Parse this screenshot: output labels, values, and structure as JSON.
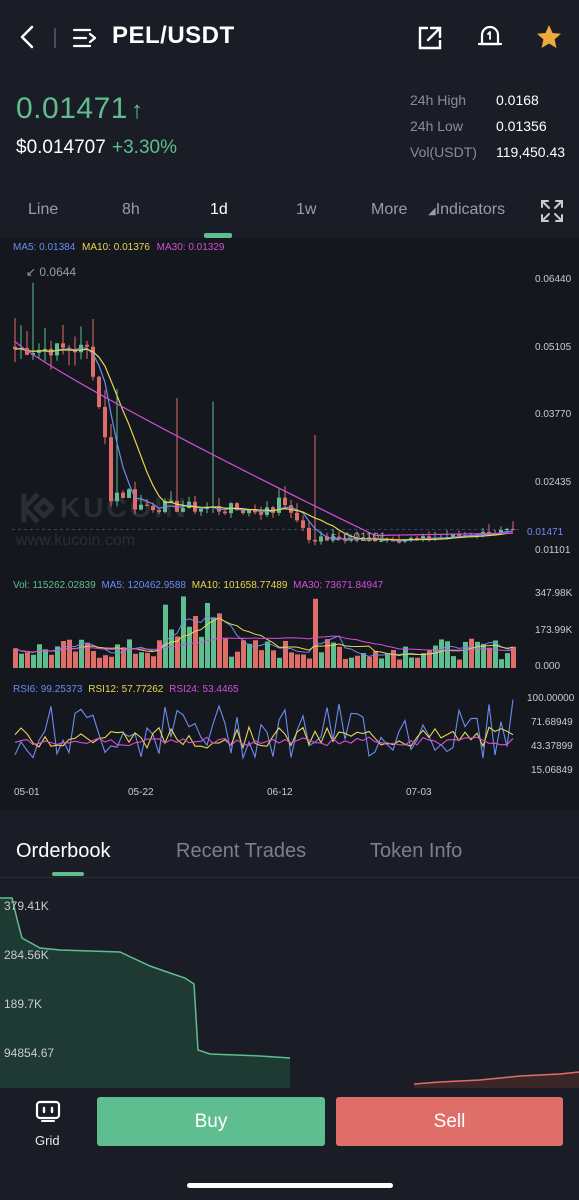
{
  "header": {
    "pair": "PEL/USDT",
    "icons": [
      "back-icon",
      "menu-icon",
      "share-icon",
      "price-alert-icon",
      "favorite-star-icon"
    ],
    "star_color": "#f0a93b"
  },
  "ticker": {
    "last_price": "0.01471",
    "arrow": "↑",
    "usd_price": "$0.014707",
    "change_pct": "+3.30%",
    "stats": [
      {
        "label": "24h High",
        "value": "0.0168"
      },
      {
        "label": "24h Low",
        "value": "0.01356"
      },
      {
        "label": "Vol(USDT)",
        "value": "119,450.43"
      }
    ]
  },
  "timeframes": {
    "items": [
      "Line",
      "8h",
      "1d",
      "1w",
      "More"
    ],
    "active": "1d",
    "indicators_label": "Indicators",
    "indicators_arrow": "◢"
  },
  "chart": {
    "ma_legend": {
      "ma5": "MA5: 0.01384",
      "ma10": "MA10: 0.01376",
      "ma30": "MA30: 0.01329"
    },
    "high_marker": "0.0644",
    "low_marker": "0.01101",
    "current_tag": "0.01471",
    "price_axis": [
      "0.06440",
      "0.05105",
      "0.03770",
      "0.02435",
      "0.01101"
    ],
    "watermark_brand": "KUCOIN",
    "watermark_url": "www.kucoin.com",
    "vol_legend": {
      "vol": "Vol: 115262.02839",
      "ma5": "MA5: 120462.9588",
      "ma10": "MA10: 101658.77489",
      "ma30": "MA30: 73671.84947"
    },
    "vol_axis": [
      "347.98K",
      "173.99K",
      "0.000"
    ],
    "rsi_legend": {
      "rsi6": "RSI6: 99.25373",
      "rsi12": "RSI12: 57.77262",
      "rsi24": "RSI24: 53.4465"
    },
    "rsi_axis": [
      "100.00000",
      "71.68949",
      "43.37899",
      "15.06849"
    ],
    "dates": [
      "05-01",
      "05-22",
      "06-12",
      "07-03"
    ],
    "colors": {
      "up": "#5ebe8f",
      "down": "#e06e68",
      "ma5": "#6b8cf2",
      "ma10": "#e8d84a",
      "ma30": "#d44fd6"
    }
  },
  "chart_data": {
    "type": "candlestick",
    "x": [
      "05-01",
      "05-22",
      "06-12",
      "07-03"
    ],
    "close_approx": [
      0.05,
      0.033,
      0.02,
      0.0175,
      0.018,
      0.0176,
      0.0172,
      0.0175,
      0.018,
      0.0178,
      0.012,
      0.0118,
      0.0125,
      0.013,
      0.0128,
      0.0135,
      0.0132,
      0.0138,
      0.014,
      0.0145,
      0.01471
    ],
    "ylim": [
      0.01101,
      0.0644
    ],
    "high": 0.0644,
    "low": 0.01101
  },
  "orderbook": {
    "tabs": [
      "Orderbook",
      "Recent Trades",
      "Token Info"
    ],
    "active": "Orderbook",
    "depth_labels": [
      "379.41K",
      "284.56K",
      "189.7K",
      "94854.67"
    ]
  },
  "bottom": {
    "grid_label": "Grid",
    "buy_label": "Buy",
    "sell_label": "Sell"
  }
}
